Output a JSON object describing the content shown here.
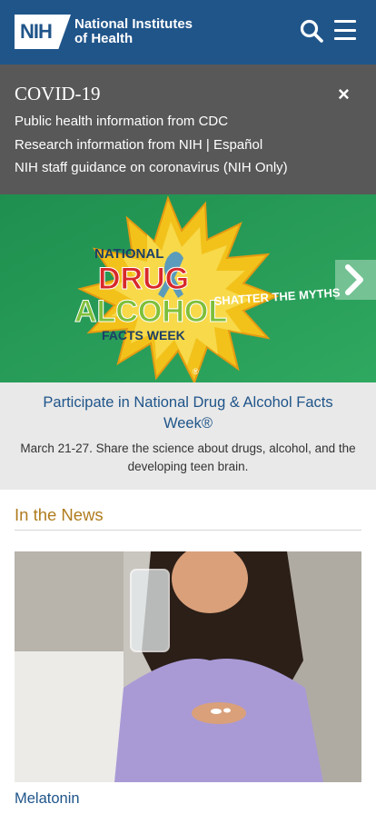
{
  "header": {
    "logo_badge": "NIH",
    "logo_line1": "National Institutes",
    "logo_line2": "of Health"
  },
  "covid": {
    "title": "COVID-19",
    "close_glyph": "×",
    "links": [
      "Public health information from CDC",
      "Research information from NIH | Español",
      "NIH staff guidance on coronavirus (NIH Only)"
    ]
  },
  "hero": {
    "line1": "NATIONAL",
    "line2": "DRUG",
    "line3": "ALCOHOL",
    "line4": "FACTS WEEK",
    "tagline": "SHATTER THE MYTHS",
    "registered": "®",
    "next_glyph": "›"
  },
  "caption": {
    "title": "Participate in National Drug & Alcohol Facts Week®",
    "description": "March 21-27. Share the science about drugs, alcohol, and the developing teen brain."
  },
  "news": {
    "heading": "In the News",
    "item_title": "Melatonin"
  },
  "colors": {
    "brand_blue": "#20558a",
    "banner_gray": "#585858",
    "accent_gold": "#b07c1e",
    "hero_green": "#2a9a56"
  },
  "icons": {
    "search": "search-icon",
    "menu": "hamburger-menu-icon",
    "close": "close-icon",
    "next": "chevron-right-icon"
  }
}
